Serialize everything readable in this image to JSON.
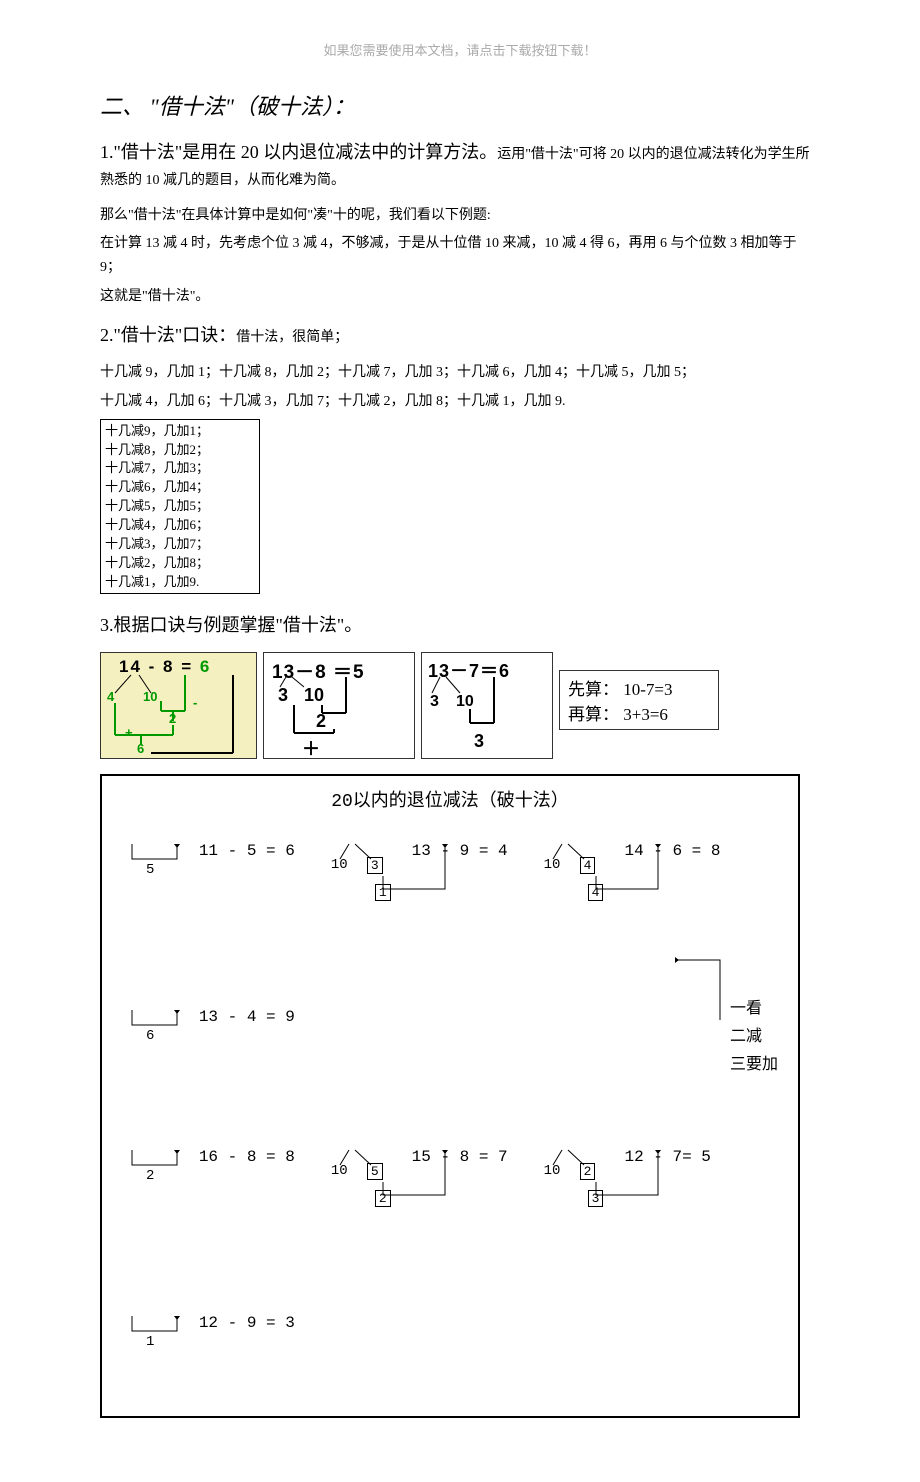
{
  "header": {
    "note": "如果您需要使用本文档，请点击下载按钮下载！"
  },
  "section": {
    "title": "二、 \"借十法\"（破十法）："
  },
  "p1": {
    "lead": "1.\"借十法\"是用在 20 以内退位减法中的计算方法。",
    "rest": "运用\"借十法\"可将 20 以内的退位减法转化为学生所熟悉的 10 减几的题目，从而化难为简。"
  },
  "p1_lines": {
    "l1": "那么\"借十法\"在具体计算中是如何\"凑\"十的呢，我们看以下例题:",
    "l2": "在计算 13 减 4 时，先考虑个位 3 减 4，不够减，于是从十位借 10 来减，10 减 4 得 6，再用 6 与个位数 3 相加等于 9；",
    "l3": "这就是\"借十法\"。"
  },
  "p2": {
    "lead": "2.\"借十法\"口诀：",
    "rest": "借十法，很简单；"
  },
  "p2_rhyme": {
    "l1": "十几减 9，几加 1；十几减 8，几加 2；十几减 7，几加 3；十几减 6，几加 4；十几减 5，几加 5；",
    "l2": "十几减 4，几加 6；十几减 3，几加 7；十几减 2，几加 8；十几减 1，几加 9."
  },
  "rhyme_box": {
    "r1": "十几减9，几加1；",
    "r2": "十几减8，几加2；",
    "r3": "十几减7，几加3；",
    "r4": "十几减6，几加4；",
    "r5": "十几减5，几加5；",
    "r6": "十几减4，几加6；",
    "r7": "十几减3，几加7；",
    "r8": "十几减2，几加8；",
    "r9": "十几减1，几加9."
  },
  "p3": {
    "title": "3.根据口诀与例题掌握\"借十法\"。"
  },
  "diagram1": {
    "equation": "14 - 8 = ",
    "result": "6",
    "split_left": "4",
    "split_right": "10",
    "step_minus": "-",
    "step_val": "2",
    "step_plus": "+",
    "final": "6"
  },
  "diagram2": {
    "equation": "13－8 ＝5",
    "n3": "3",
    "n10": "10",
    "n2": "2",
    "plus": "＋"
  },
  "diagram3": {
    "equation": "13－7＝6",
    "n3": "3",
    "n10": "10",
    "nr": "3"
  },
  "diagram4": {
    "l1": "先算： 10-7=3",
    "l2": "再算： 3+3=6"
  },
  "big": {
    "title": "20以内的退位减法（破十法）",
    "eq1": {
      "text": "11 - 5 = 6",
      "below": "5"
    },
    "eq2": {
      "text": "13 - 9 = 4",
      "a": "10",
      "b": "3",
      "c": "1"
    },
    "eq3": {
      "text": "14 - 6 = 8",
      "a": "10",
      "b": "4",
      "c": "4"
    },
    "eq4": {
      "text": "13 - 4 = 9",
      "below": "6"
    },
    "notes": {
      "n1": "一看",
      "n2": "二减",
      "n3": "三要加"
    },
    "eq5": {
      "text": "16 - 8 = 8",
      "below": "2"
    },
    "eq6": {
      "text": "15 - 8 = 7",
      "a": "10",
      "b": "5",
      "c": "2"
    },
    "eq7": {
      "text": "12 - 7= 5",
      "a": "10",
      "b": "2",
      "c": "3"
    },
    "eq8": {
      "text": "12 - 9 = 3",
      "below": "1"
    }
  }
}
